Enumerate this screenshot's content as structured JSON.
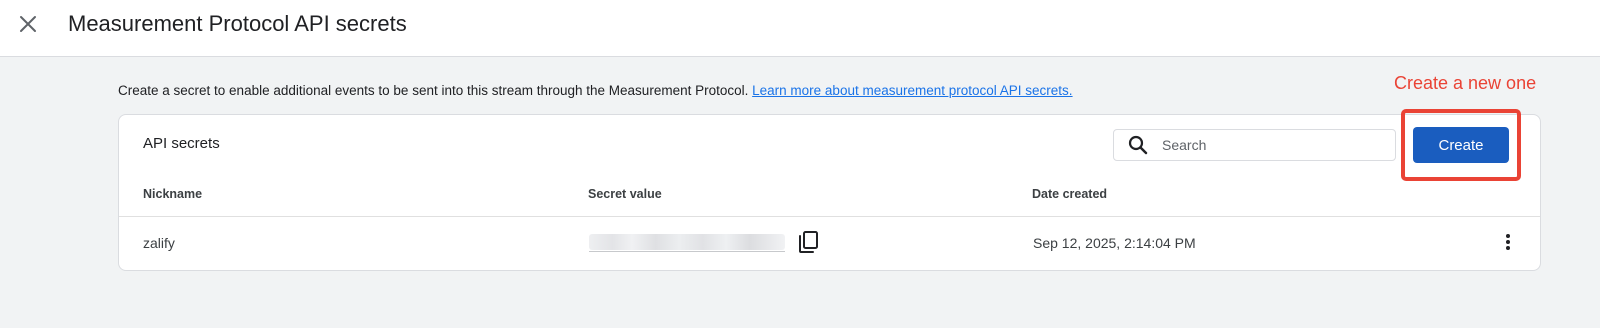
{
  "header": {
    "title": "Measurement Protocol API secrets"
  },
  "intro": {
    "text": "Create a secret to enable additional events to be sent into this stream through the Measurement Protocol.",
    "link": "Learn more about measurement protocol API secrets."
  },
  "annotation": {
    "text": "Create a new one",
    "color": "#ea4335"
  },
  "card": {
    "title": "API secrets",
    "search": {
      "placeholder": "Search",
      "value": ""
    },
    "create_label": "Create",
    "columns": [
      "Nickname",
      "Secret value",
      "Date created"
    ],
    "rows": [
      {
        "nickname": "zalify",
        "date_created": "Sep 12, 2025, 2:14:04 PM"
      }
    ]
  },
  "colors": {
    "accent": "#1a5dbf",
    "link": "#1a73e8",
    "background": "#f1f3f4"
  },
  "icons": [
    "close-icon",
    "search-icon",
    "copy-icon",
    "more-vert-icon"
  ]
}
